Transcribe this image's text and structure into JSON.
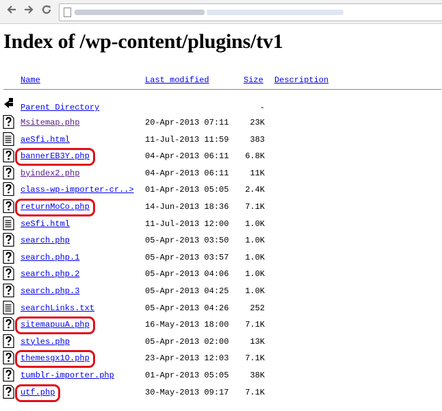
{
  "browser": {
    "back_icon": "arrow-left-icon",
    "forward_icon": "arrow-right-icon",
    "reload_icon": "reload-icon"
  },
  "page": {
    "title": "Index of /wp-content/plugins/tv1"
  },
  "columns": {
    "name": "Name",
    "modified": "Last modified",
    "size": "Size",
    "description": "Description"
  },
  "parent": {
    "label": "Parent Directory",
    "size": "-",
    "icon": "folder-back-icon"
  },
  "files": [
    {
      "name": "Msitemap.php",
      "modified": "20-Apr-2013 07:11",
      "size": "23K",
      "icon": "unknown-file-icon",
      "visited": true,
      "highlighted": false
    },
    {
      "name": "aeSfi.html",
      "modified": "11-Jul-2013 11:59",
      "size": "383",
      "icon": "text-file-icon",
      "visited": false,
      "highlighted": false
    },
    {
      "name": "bannerEB3Y.php",
      "modified": "04-Apr-2013 06:11",
      "size": "6.8K",
      "icon": "unknown-file-icon",
      "visited": false,
      "highlighted": true
    },
    {
      "name": "byindex2.php",
      "modified": "04-Apr-2013 06:11",
      "size": "11K",
      "icon": "unknown-file-icon",
      "visited": true,
      "highlighted": false
    },
    {
      "name": "class-wp-importer-cr..>",
      "modified": "01-Apr-2013 05:05",
      "size": "2.4K",
      "icon": "unknown-file-icon",
      "visited": false,
      "highlighted": false
    },
    {
      "name": "returnMoCo.php",
      "modified": "14-Jun-2013 18:36",
      "size": "7.1K",
      "icon": "unknown-file-icon",
      "visited": false,
      "highlighted": true
    },
    {
      "name": "seSfi.html",
      "modified": "11-Jul-2013 12:00",
      "size": "1.0K",
      "icon": "text-file-icon",
      "visited": false,
      "highlighted": false
    },
    {
      "name": "search.php",
      "modified": "05-Apr-2013 03:50",
      "size": "1.0K",
      "icon": "unknown-file-icon",
      "visited": false,
      "highlighted": false
    },
    {
      "name": "search.php.1",
      "modified": "05-Apr-2013 03:57",
      "size": "1.0K",
      "icon": "unknown-file-icon",
      "visited": false,
      "highlighted": false
    },
    {
      "name": "search.php.2",
      "modified": "05-Apr-2013 04:06",
      "size": "1.0K",
      "icon": "unknown-file-icon",
      "visited": false,
      "highlighted": false
    },
    {
      "name": "search.php.3",
      "modified": "05-Apr-2013 04:25",
      "size": "1.0K",
      "icon": "unknown-file-icon",
      "visited": false,
      "highlighted": false
    },
    {
      "name": "searchLinks.txt",
      "modified": "05-Apr-2013 04:26",
      "size": "252",
      "icon": "text-file-icon",
      "visited": false,
      "highlighted": false
    },
    {
      "name": "sitemapuuA.php",
      "modified": "16-May-2013 18:00",
      "size": "7.1K",
      "icon": "unknown-file-icon",
      "visited": false,
      "highlighted": true
    },
    {
      "name": "styles.php",
      "modified": "05-Apr-2013 02:00",
      "size": "13K",
      "icon": "unknown-file-icon",
      "visited": false,
      "highlighted": false
    },
    {
      "name": "themesgx1O.php",
      "modified": "23-Apr-2013 12:03",
      "size": "7.1K",
      "icon": "unknown-file-icon",
      "visited": false,
      "highlighted": true
    },
    {
      "name": "tumblr-importer.php",
      "modified": "01-Apr-2013 05:05",
      "size": "38K",
      "icon": "unknown-file-icon",
      "visited": false,
      "highlighted": false
    },
    {
      "name": "utf.php",
      "modified": "30-May-2013 09:17",
      "size": "7.1K",
      "icon": "unknown-file-icon",
      "visited": false,
      "highlighted": true
    }
  ],
  "colors": {
    "link": "#0000ee",
    "visited_link": "#551a8b",
    "highlight": "#e0101a"
  }
}
